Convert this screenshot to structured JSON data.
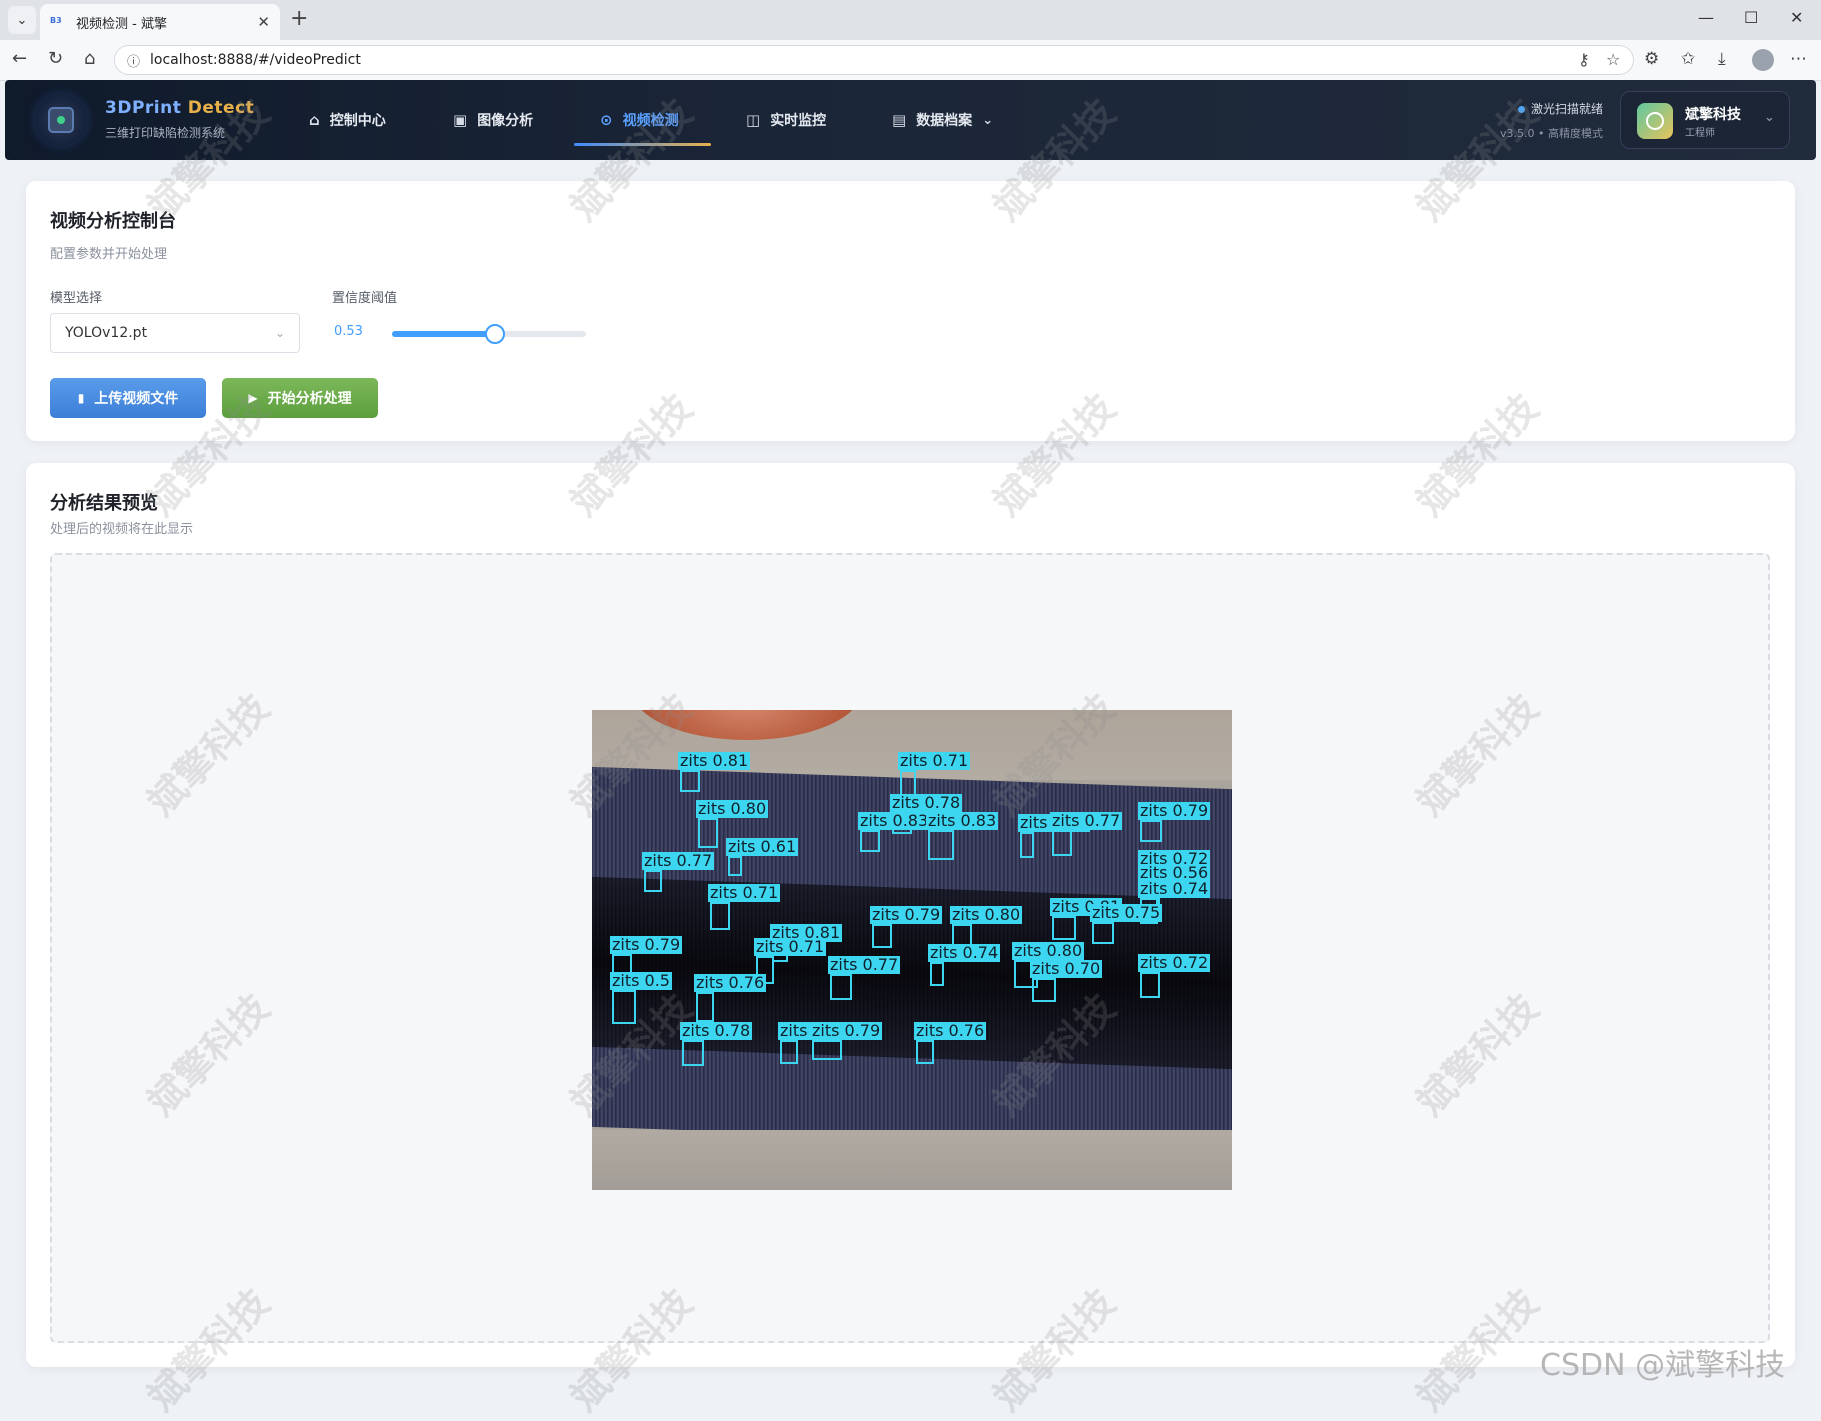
{
  "browser": {
    "tab_title": "视频检测 - 斌擎",
    "tab_favicon": "B3",
    "url": "localhost:8888/#/videoPredict"
  },
  "header": {
    "brand_main": "3DPrint ",
    "brand_accent": "Detect",
    "brand_sub": "三维打印缺陷检测系统",
    "nav": [
      {
        "label": "控制中心",
        "icon": "home-icon"
      },
      {
        "label": "图像分析",
        "icon": "image-icon"
      },
      {
        "label": "视频检测",
        "icon": "play-circle-icon",
        "active": true
      },
      {
        "label": "实时监控",
        "icon": "camera-icon"
      },
      {
        "label": "数据档案",
        "icon": "document-icon",
        "has_dropdown": true
      }
    ],
    "status_text": "激光扫描就绪",
    "status_sub": "v3.5.0 • 高精度模式",
    "user_name": "斌擎科技",
    "user_role": "工程师"
  },
  "control_panel": {
    "title": "视频分析控制台",
    "subtitle": "配置参数并开始处理",
    "model_label": "模型选择",
    "model_value": "YOLOv12.pt",
    "confidence_label": "置信度阈值",
    "confidence_value": "0.53",
    "confidence_fraction": 0.53,
    "upload_button": "上传视频文件",
    "start_button": "开始分析处理"
  },
  "preview": {
    "title": "分析结果预览",
    "subtitle": "处理后的视频将在此显示",
    "detections": [
      {
        "label": "zits 0.81"
      },
      {
        "label": "zits 0.71"
      },
      {
        "label": "zits 0.80"
      },
      {
        "label": "zits 0.78"
      },
      {
        "label": "zits 0.83"
      },
      {
        "label": "zits 0.83"
      },
      {
        "label": "zits 0.79"
      },
      {
        "label": "zits 0.77"
      },
      {
        "label": "zits 0.79"
      },
      {
        "label": "zits 0.61"
      },
      {
        "label": "zits 0.77"
      },
      {
        "label": "zits 0.72"
      },
      {
        "label": "zits 0.56"
      },
      {
        "label": "zits 0.74"
      },
      {
        "label": "zits 0.71"
      },
      {
        "label": "zits 0.79"
      },
      {
        "label": "zits 0.80"
      },
      {
        "label": "zits 0.81"
      },
      {
        "label": "zits 0.75"
      },
      {
        "label": "zits 0.81"
      },
      {
        "label": "zits 0.79"
      },
      {
        "label": "zits 0.71"
      },
      {
        "label": "zits 0.80"
      },
      {
        "label": "zits 0.77"
      },
      {
        "label": "zits 0.74"
      },
      {
        "label": "zits 0.70"
      },
      {
        "label": "zits 0.72"
      },
      {
        "label": "zits 0.5"
      },
      {
        "label": "zits 0.76"
      },
      {
        "label": "zits 0.78"
      },
      {
        "label": "zits 0.77"
      },
      {
        "label": "zits 0.79"
      },
      {
        "label": "zits 0.76"
      }
    ]
  },
  "watermark_text": "斌擎科技",
  "csdn_watermark": "CSDN @斌擎科技"
}
